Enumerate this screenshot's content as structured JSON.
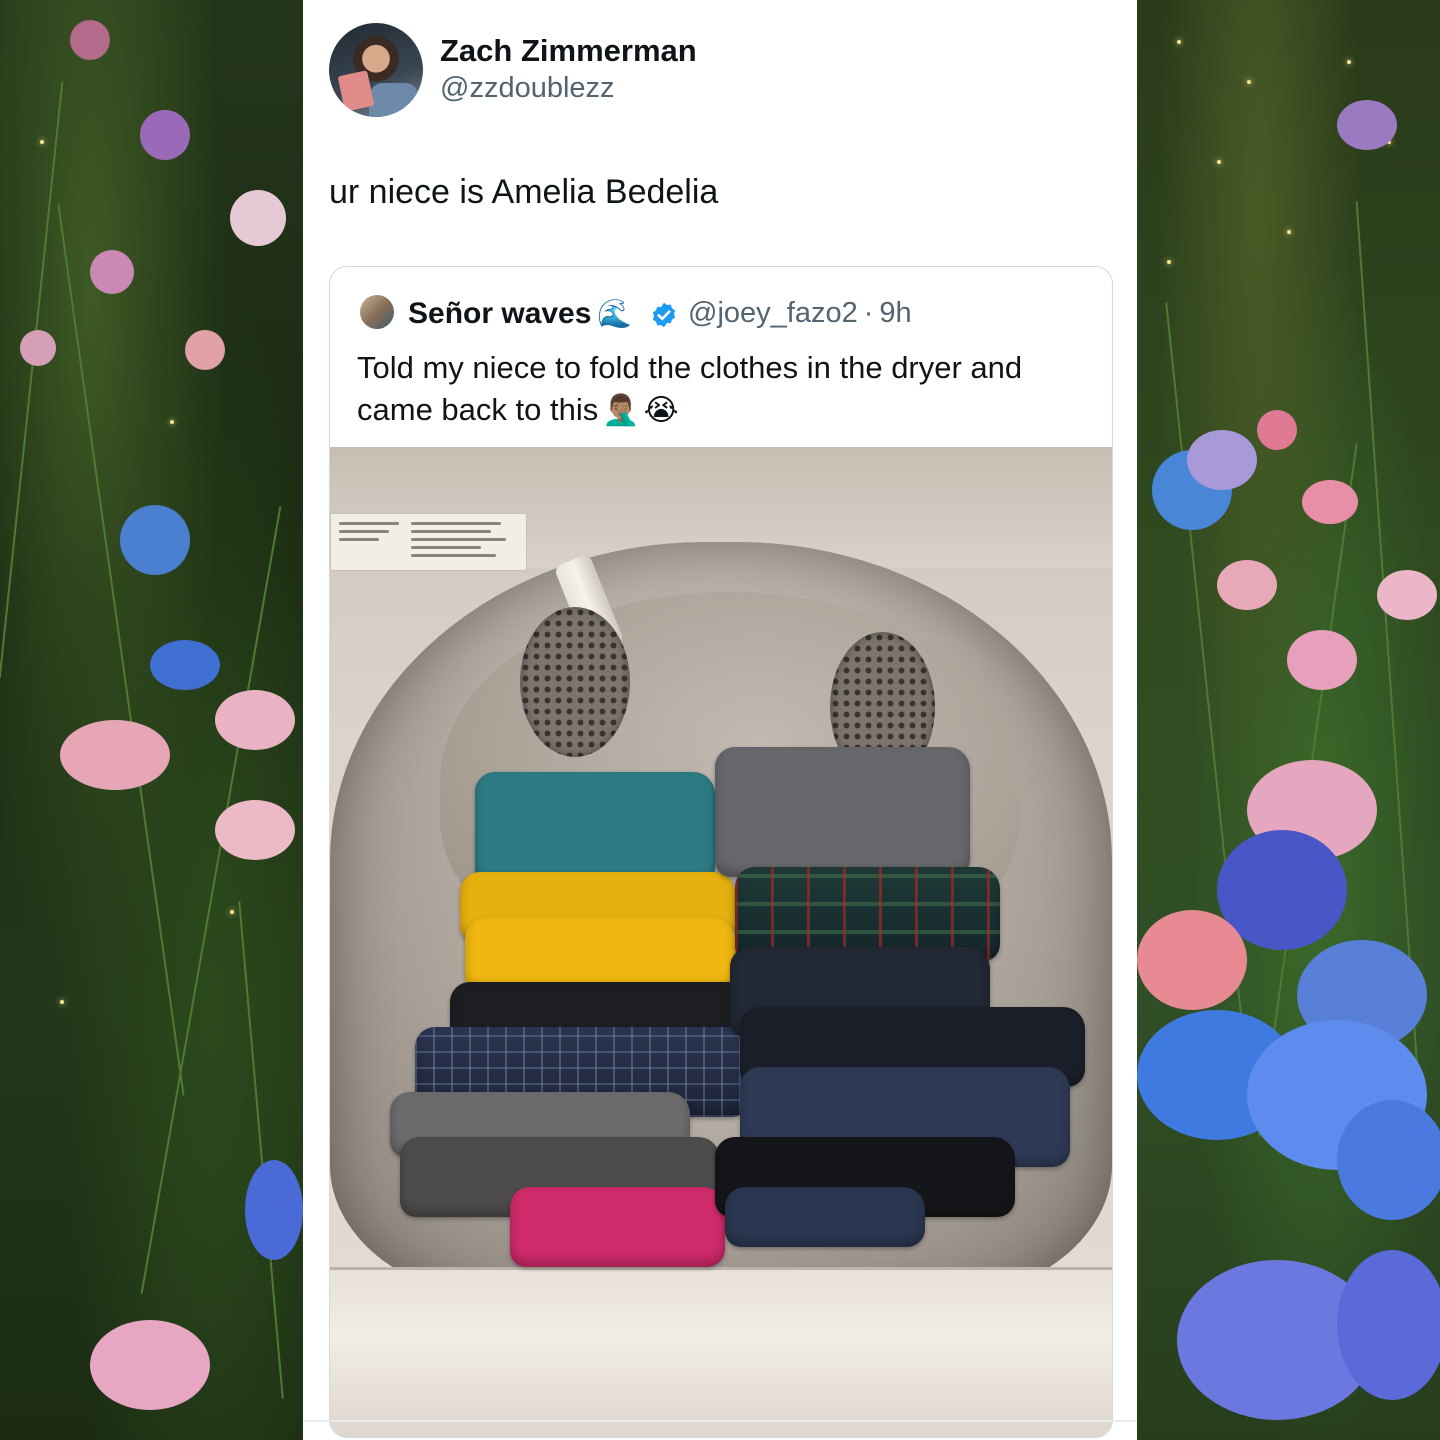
{
  "tweet": {
    "author_name": "Zach Zimmerman",
    "author_handle": "@zzdoublezz",
    "text": "ur niece is Amelia Bedelia",
    "avatar_icon": "profile-photo"
  },
  "quoted_tweet": {
    "author_name": "Señor waves",
    "name_emoji": "🌊",
    "verified_icon": "verified-badge-icon",
    "handle": "@joey_fazo2",
    "separator": "·",
    "time": "9h",
    "text": "Told my niece to fold the clothes in the dryer and came back to this",
    "emojis": [
      "🤦🏽‍♂️",
      "😭"
    ],
    "image_description_icon": "dryer-photo"
  },
  "colors": {
    "text_primary": "#0f1419",
    "text_secondary": "#536471",
    "verified_blue": "#1d9bf0",
    "card_border": "#cfd9de"
  }
}
